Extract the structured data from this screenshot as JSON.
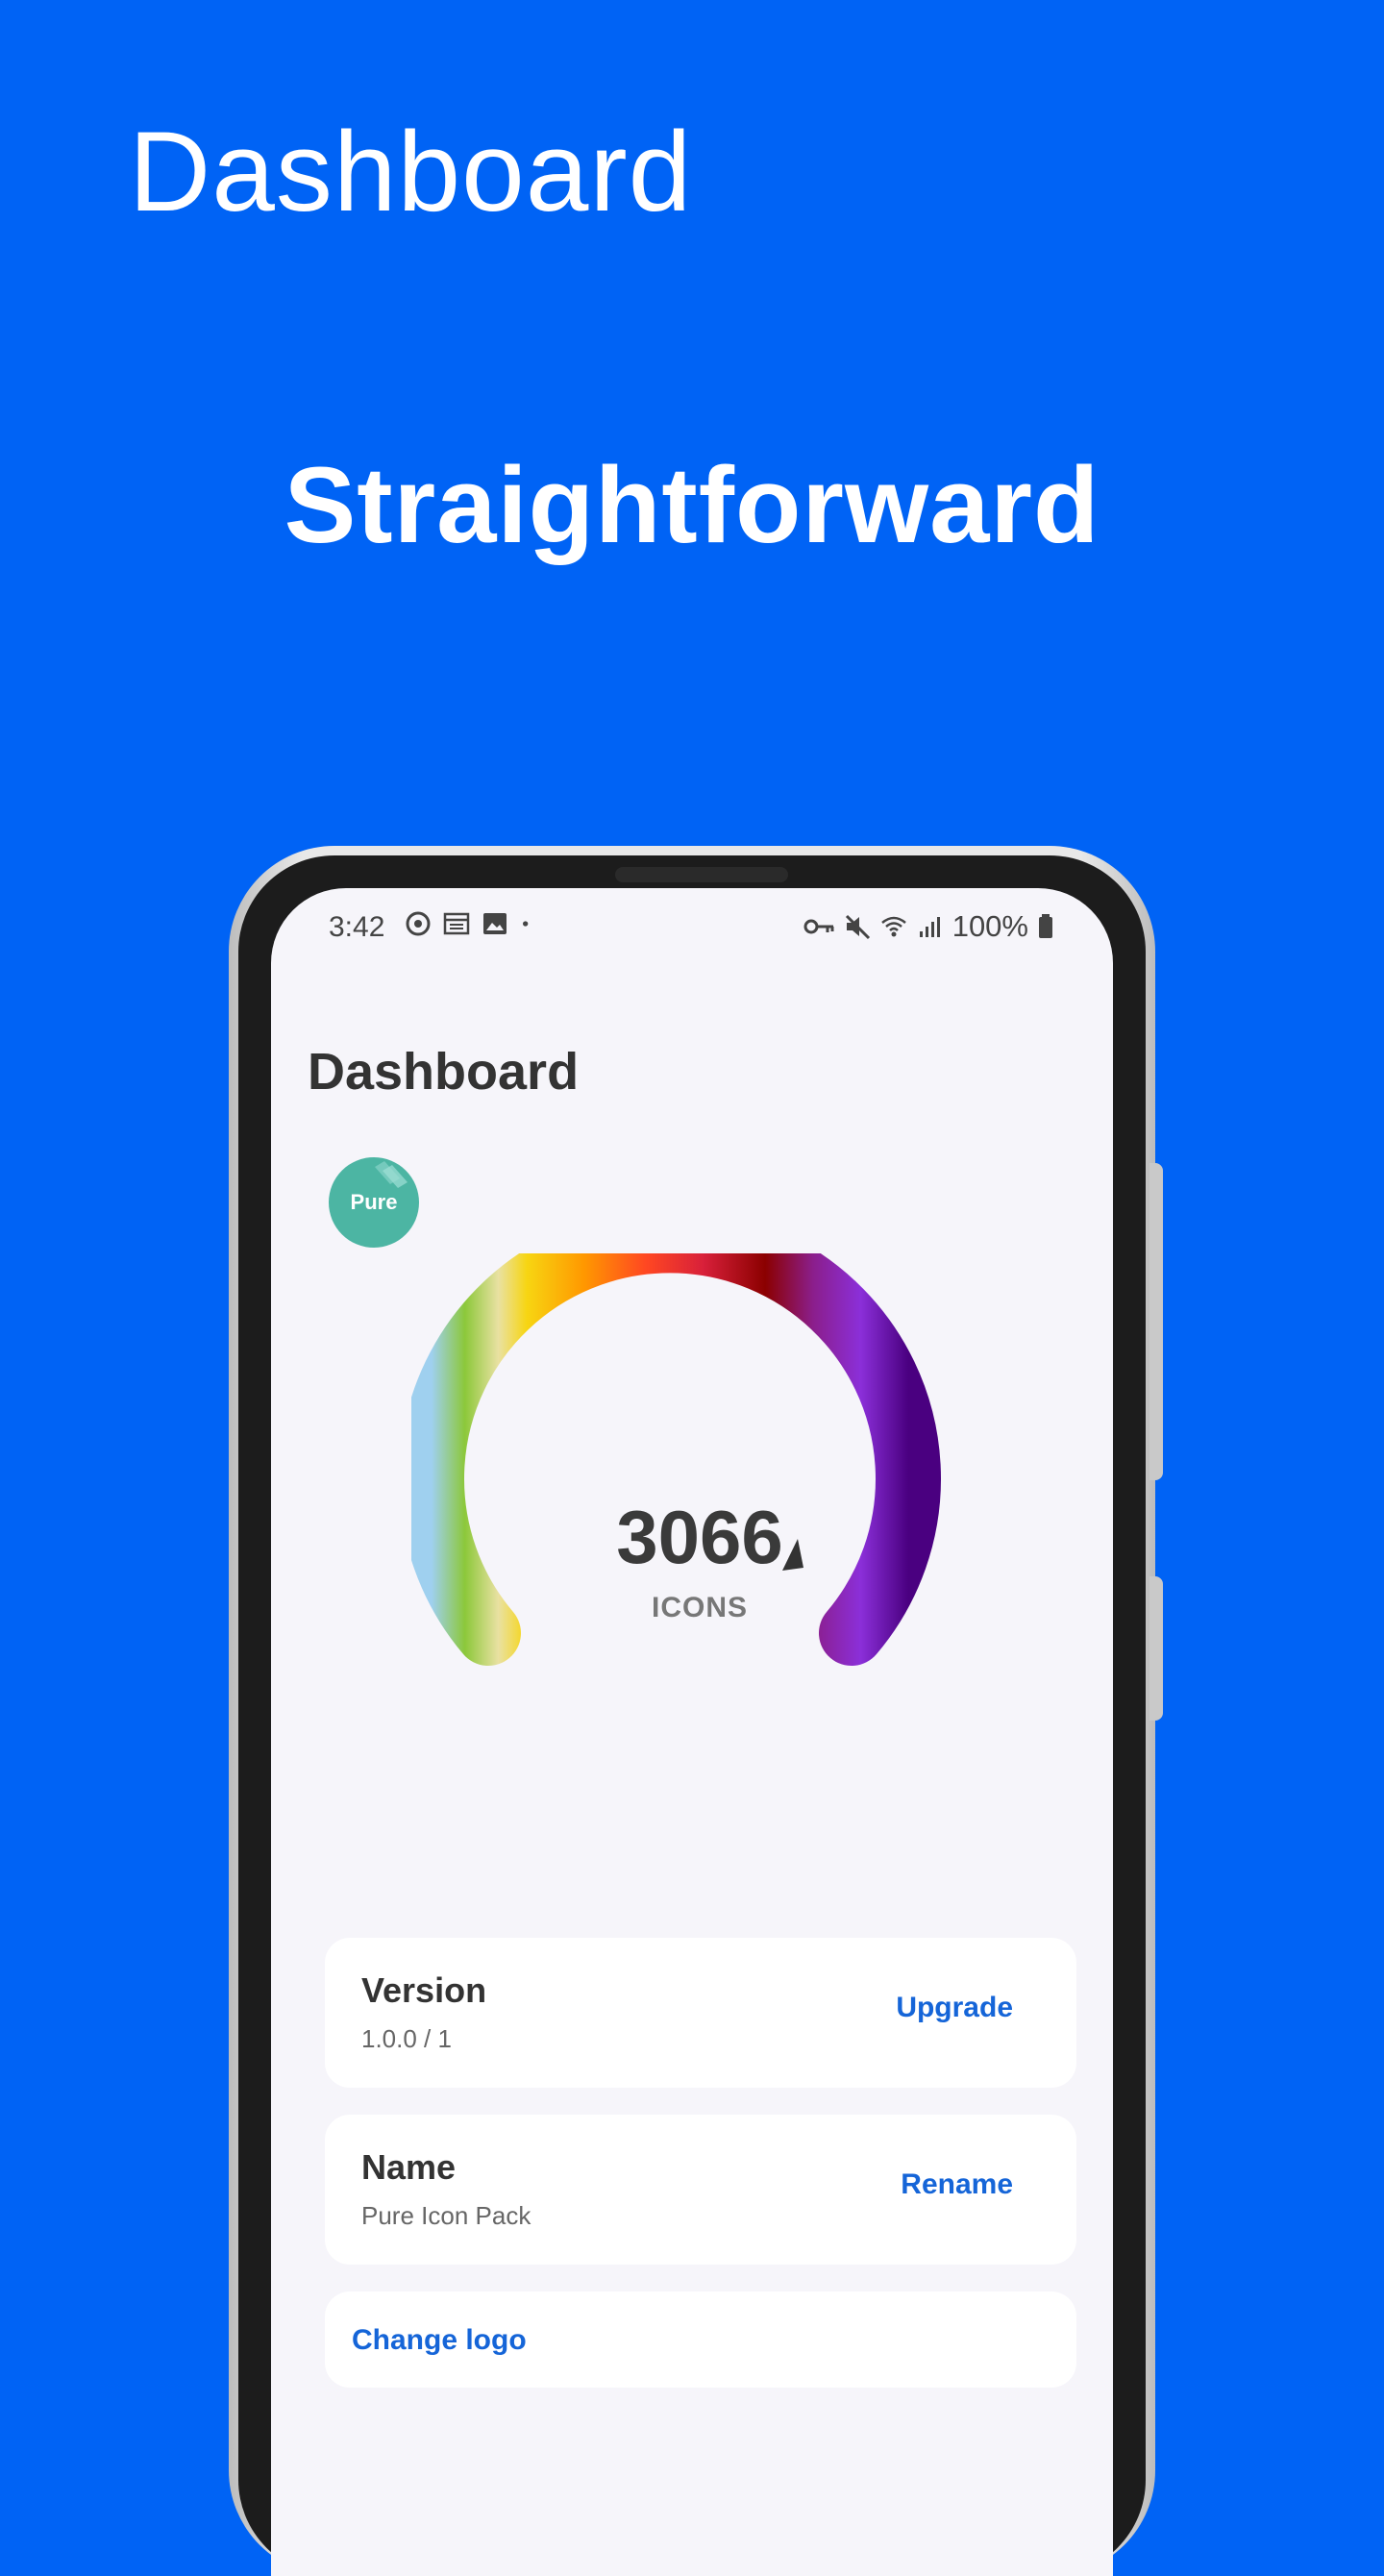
{
  "promo": {
    "title": "Dashboard",
    "tagline": "Straightforward"
  },
  "status_bar": {
    "time": "3:42",
    "battery": "100%",
    "left_icons": [
      "sync-icon",
      "news-icon",
      "gallery-icon",
      "dot-icon"
    ],
    "right_icons": [
      "key-icon",
      "mute-icon",
      "wifi-icon",
      "signal-icon",
      "battery-icon"
    ]
  },
  "screen": {
    "title": "Dashboard",
    "logo_text": "Pure",
    "gauge": {
      "count": "3066",
      "label": "ICONS"
    },
    "cards": {
      "version": {
        "title": "Version",
        "value": "1.0.0 / 1",
        "action": "Upgrade"
      },
      "name": {
        "title": "Name",
        "value": "Pure Icon Pack",
        "action": "Rename"
      },
      "logo": {
        "action": "Change logo"
      }
    }
  },
  "colors": {
    "background": "#0063f5",
    "accent": "#1565d8",
    "screen_bg": "#f6f5fa"
  }
}
